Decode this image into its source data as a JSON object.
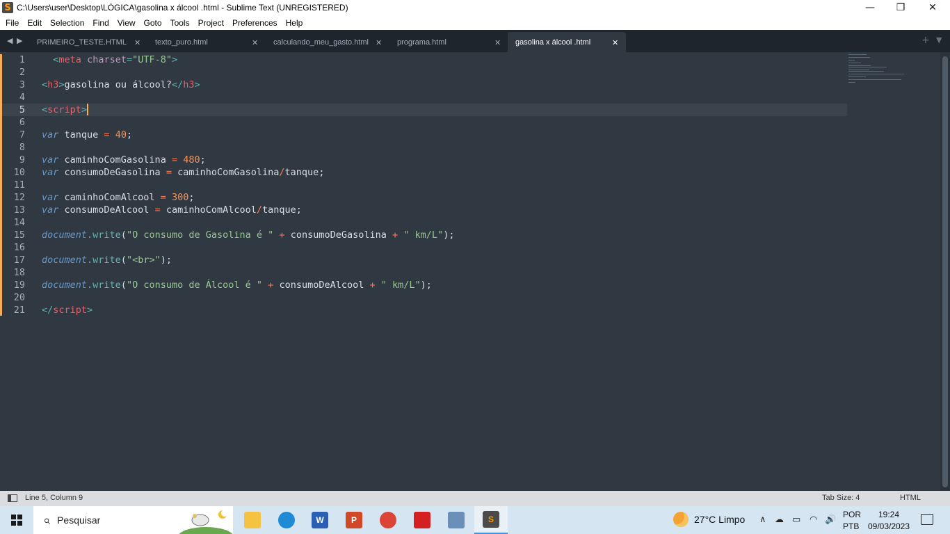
{
  "window": {
    "title": "C:\\Users\\user\\Desktop\\LÓGICA\\gasolina x álcool .html - Sublime Text (UNREGISTERED)",
    "app_logo": "S",
    "minimize_glyph": "—",
    "maximize_glyph": "❐",
    "close_glyph": "✕"
  },
  "menu": [
    "File",
    "Edit",
    "Selection",
    "Find",
    "View",
    "Goto",
    "Tools",
    "Project",
    "Preferences",
    "Help"
  ],
  "tabs": [
    {
      "label": "PRIMEIRO_TESTE.HTML",
      "active": false
    },
    {
      "label": "texto_puro.html",
      "active": false
    },
    {
      "label": "calculando_meu_gasto.html",
      "active": false
    },
    {
      "label": "programa.html",
      "active": false
    },
    {
      "label": "gasolina x álcool .html",
      "active": true
    }
  ],
  "tab_controls": {
    "prev": "◀",
    "next": "▶",
    "close": "✕",
    "add": "+",
    "overflow": "▼"
  },
  "editor": {
    "current_line": 5,
    "lines": [
      {
        "n": "1",
        "tokens": [
          {
            "t": "  "
          },
          {
            "t": "<",
            "c": "t-punct"
          },
          {
            "t": "meta",
            "c": "t-tag"
          },
          {
            "t": " "
          },
          {
            "t": "charset",
            "c": "t-attr"
          },
          {
            "t": "=",
            "c": "t-punct"
          },
          {
            "t": "\"UTF-8\"",
            "c": "t-str"
          },
          {
            "t": ">",
            "c": "t-punct"
          }
        ]
      },
      {
        "n": "2",
        "tokens": []
      },
      {
        "n": "3",
        "tokens": [
          {
            "t": "<",
            "c": "t-punct"
          },
          {
            "t": "h3",
            "c": "t-tag"
          },
          {
            "t": ">",
            "c": "t-punct"
          },
          {
            "t": "gasolina ou álcool?"
          },
          {
            "t": "</",
            "c": "t-punct"
          },
          {
            "t": "h3",
            "c": "t-tag"
          },
          {
            "t": ">",
            "c": "t-punct"
          }
        ]
      },
      {
        "n": "4",
        "tokens": []
      },
      {
        "n": "5",
        "tokens": [
          {
            "t": "<",
            "c": "t-punct"
          },
          {
            "t": "script",
            "c": "t-tag"
          },
          {
            "t": ">",
            "c": "t-punct"
          }
        ]
      },
      {
        "n": "6",
        "tokens": []
      },
      {
        "n": "7",
        "tokens": [
          {
            "t": "var",
            "c": "t-kw"
          },
          {
            "t": " tanque "
          },
          {
            "t": "=",
            "c": "t-op"
          },
          {
            "t": " "
          },
          {
            "t": "40",
            "c": "t-num"
          },
          {
            "t": ";"
          }
        ]
      },
      {
        "n": "8",
        "tokens": []
      },
      {
        "n": "9",
        "tokens": [
          {
            "t": "var",
            "c": "t-kw"
          },
          {
            "t": " caminhoComGasolina "
          },
          {
            "t": "=",
            "c": "t-op"
          },
          {
            "t": " "
          },
          {
            "t": "480",
            "c": "t-num"
          },
          {
            "t": ";"
          }
        ]
      },
      {
        "n": "10",
        "tokens": [
          {
            "t": "var",
            "c": "t-kw"
          },
          {
            "t": " consumoDeGasolina "
          },
          {
            "t": "=",
            "c": "t-op"
          },
          {
            "t": " caminhoComGasolina"
          },
          {
            "t": "/",
            "c": "t-op"
          },
          {
            "t": "tanque;"
          }
        ]
      },
      {
        "n": "11",
        "tokens": []
      },
      {
        "n": "12",
        "tokens": [
          {
            "t": "var",
            "c": "t-kw"
          },
          {
            "t": " caminhoComAlcool "
          },
          {
            "t": "=",
            "c": "t-op"
          },
          {
            "t": " "
          },
          {
            "t": "300",
            "c": "t-num"
          },
          {
            "t": ";"
          }
        ]
      },
      {
        "n": "13",
        "tokens": [
          {
            "t": "var",
            "c": "t-kw"
          },
          {
            "t": " consumoDeAlcool "
          },
          {
            "t": "=",
            "c": "t-op"
          },
          {
            "t": " caminhoComAlcool"
          },
          {
            "t": "/",
            "c": "t-op"
          },
          {
            "t": "tanque;"
          }
        ]
      },
      {
        "n": "14",
        "tokens": []
      },
      {
        "n": "15",
        "tokens": [
          {
            "t": "document",
            "c": "t-obj"
          },
          {
            "t": ".",
            "c": "t-punct"
          },
          {
            "t": "write",
            "c": "t-fn"
          },
          {
            "t": "("
          },
          {
            "t": "\"O consumo de Gasolina é \"",
            "c": "t-str"
          },
          {
            "t": " "
          },
          {
            "t": "+",
            "c": "t-op"
          },
          {
            "t": " consumoDeGasolina "
          },
          {
            "t": "+",
            "c": "t-op"
          },
          {
            "t": " "
          },
          {
            "t": "\" km/L\"",
            "c": "t-str"
          },
          {
            "t": ");"
          }
        ]
      },
      {
        "n": "16",
        "tokens": []
      },
      {
        "n": "17",
        "tokens": [
          {
            "t": "document",
            "c": "t-obj"
          },
          {
            "t": ".",
            "c": "t-punct"
          },
          {
            "t": "write",
            "c": "t-fn"
          },
          {
            "t": "("
          },
          {
            "t": "\"<br>\"",
            "c": "t-str"
          },
          {
            "t": ");"
          }
        ]
      },
      {
        "n": "18",
        "tokens": []
      },
      {
        "n": "19",
        "tokens": [
          {
            "t": "document",
            "c": "t-obj"
          },
          {
            "t": ".",
            "c": "t-punct"
          },
          {
            "t": "write",
            "c": "t-fn"
          },
          {
            "t": "("
          },
          {
            "t": "\"O consumo de Álcool é \"",
            "c": "t-str"
          },
          {
            "t": " "
          },
          {
            "t": "+",
            "c": "t-op"
          },
          {
            "t": " consumoDeAlcool "
          },
          {
            "t": "+",
            "c": "t-op"
          },
          {
            "t": " "
          },
          {
            "t": "\" km/L\"",
            "c": "t-str"
          },
          {
            "t": ");"
          }
        ]
      },
      {
        "n": "20",
        "tokens": []
      },
      {
        "n": "21",
        "tokens": [
          {
            "t": "</",
            "c": "t-punct"
          },
          {
            "t": "script",
            "c": "t-tag"
          },
          {
            "t": ">",
            "c": "t-punct"
          }
        ]
      }
    ]
  },
  "status": {
    "position": "Line 5, Column 9",
    "tab_size": "Tab Size: 4",
    "syntax": "HTML"
  },
  "taskbar": {
    "search_placeholder": "Pesquisar",
    "search_icon": "⌕",
    "apps": [
      {
        "name": "file-explorer",
        "label": "",
        "color": "#f5c242"
      },
      {
        "name": "edge",
        "label": "",
        "color": "#1f8ad6"
      },
      {
        "name": "word",
        "label": "W",
        "color": "#2b5fb4"
      },
      {
        "name": "powerpoint",
        "label": "P",
        "color": "#d04a2a"
      },
      {
        "name": "chrome",
        "label": "",
        "color": "#db4437"
      },
      {
        "name": "acrobat",
        "label": "",
        "color": "#d42020"
      },
      {
        "name": "control-panel",
        "label": "",
        "color": "#6a8fb8"
      },
      {
        "name": "sublime-text",
        "label": "S",
        "color": "#4b4b4b"
      }
    ],
    "weather": "27°C  Limpo",
    "tray": {
      "chevron": "∧",
      "cloud": "☁",
      "battery": "▭",
      "wifi": "◠",
      "volume": "🔊"
    },
    "language": [
      "POR",
      "PTB"
    ],
    "time": "19:24",
    "date": "09/03/2023"
  }
}
